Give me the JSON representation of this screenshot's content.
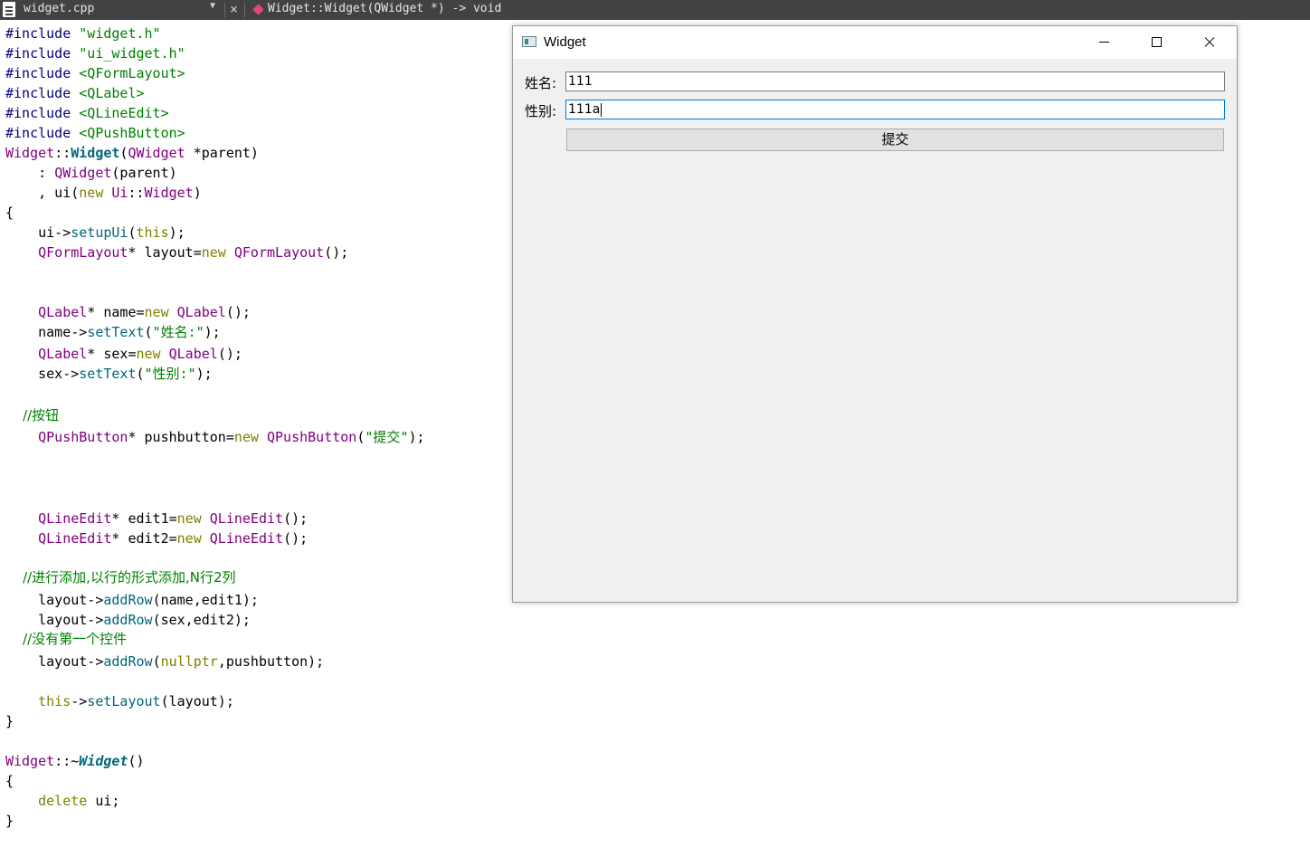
{
  "editor_toolbar": {
    "file_name": "widget.cpp",
    "symbol": "Widget::Widget(QWidget *) -> void"
  },
  "code": {
    "l1_directive": "#include",
    "l1_file": "\"widget.h\"",
    "l2_directive": "#include",
    "l2_file": "\"ui_widget.h\"",
    "l3_directive": "#include",
    "l3_file": "<QFormLayout>",
    "l4_directive": "#include",
    "l4_file": "<QLabel>",
    "l5_directive": "#include",
    "l5_file": "<QLineEdit>",
    "l6_directive": "#include",
    "l6_file": "<QPushButton>",
    "l7_class": "Widget",
    "l7_sep": "::",
    "l7_ctor": "Widget",
    "l7_open": "(",
    "l7_type": "QWidget",
    "l7_rest": " *parent)",
    "l8_pre": "    : ",
    "l8_base": "QWidget",
    "l8_rest": "(parent)",
    "l9_pre": "    , ui(",
    "l9_new": "new",
    "l9_sp": " ",
    "l9_ns": "Ui",
    "l9_sep": "::",
    "l9_cls": "Widget",
    "l9_close": ")",
    "l10": "{",
    "l11_pre": "    ui->",
    "l11_fn": "setupUi",
    "l11_open": "(",
    "l11_this": "this",
    "l11_close": ");",
    "l12_pre": "    ",
    "l12_type": "QFormLayout",
    "l12_mid": "* layout=",
    "l12_new": "new",
    "l12_sp": " ",
    "l12_ctor": "QFormLayout",
    "l12_close": "();",
    "l13_pre": "    ",
    "l13_type": "QLabel",
    "l13_mid": "* name=",
    "l13_new": "new",
    "l13_sp": " ",
    "l13_ctor": "QLabel",
    "l13_close": "();",
    "l14_pre": "    name->",
    "l14_fn": "setText",
    "l14_open": "(",
    "l14_str": "\"姓名:\"",
    "l14_close": ");",
    "l15_pre": "    ",
    "l15_type": "QLabel",
    "l15_mid": "* sex=",
    "l15_new": "new",
    "l15_sp": " ",
    "l15_ctor": "QLabel",
    "l15_close": "();",
    "l16_pre": "    sex->",
    "l16_fn": "setText",
    "l16_open": "(",
    "l16_str": "\"性别:\"",
    "l16_close": ");",
    "l17_comment": "    //按钮",
    "l18_pre": "    ",
    "l18_type": "QPushButton",
    "l18_mid": "* pushbutton=",
    "l18_new": "new",
    "l18_sp": " ",
    "l18_ctor": "QPushButton",
    "l18_open": "(",
    "l18_str": "\"提交\"",
    "l18_close": ");",
    "l19_pre": "    ",
    "l19_type": "QLineEdit",
    "l19_mid": "* edit1=",
    "l19_new": "new",
    "l19_sp": " ",
    "l19_ctor": "QLineEdit",
    "l19_close": "();",
    "l20_pre": "    ",
    "l20_type": "QLineEdit",
    "l20_mid": "* edit2=",
    "l20_new": "new",
    "l20_sp": " ",
    "l20_ctor": "QLineEdit",
    "l20_close": "();",
    "l21_comment": "    //进行添加,以行的形式添加,N行2列",
    "l22_pre": "    layout->",
    "l22_fn": "addRow",
    "l22_args": "(name,edit1);",
    "l23_pre": "    layout->",
    "l23_fn": "addRow",
    "l23_args": "(sex,edit2);",
    "l24_comment": "    //没有第一个控件",
    "l25_pre": "    layout->",
    "l25_fn": "addRow",
    "l25_open": "(",
    "l25_kw": "nullptr",
    "l25_args": ",pushbutton);",
    "l26_pre": "    ",
    "l26_this": "this",
    "l26_arrow": "->",
    "l26_fn": "setLayout",
    "l26_args": "(layout);",
    "l27": "}",
    "l28_class": "Widget",
    "l28_sep": "::~",
    "l28_dtor": "Widget",
    "l28_close": "()",
    "l29": "{",
    "l30_pre": "    ",
    "l30_kw": "delete",
    "l30_rest": " ui;",
    "l31": "}"
  },
  "window": {
    "title": "Widget",
    "form": {
      "name_label": "姓名:",
      "name_value": "111",
      "sex_label": "性别:",
      "sex_value": "111a",
      "submit_label": "提交"
    }
  }
}
